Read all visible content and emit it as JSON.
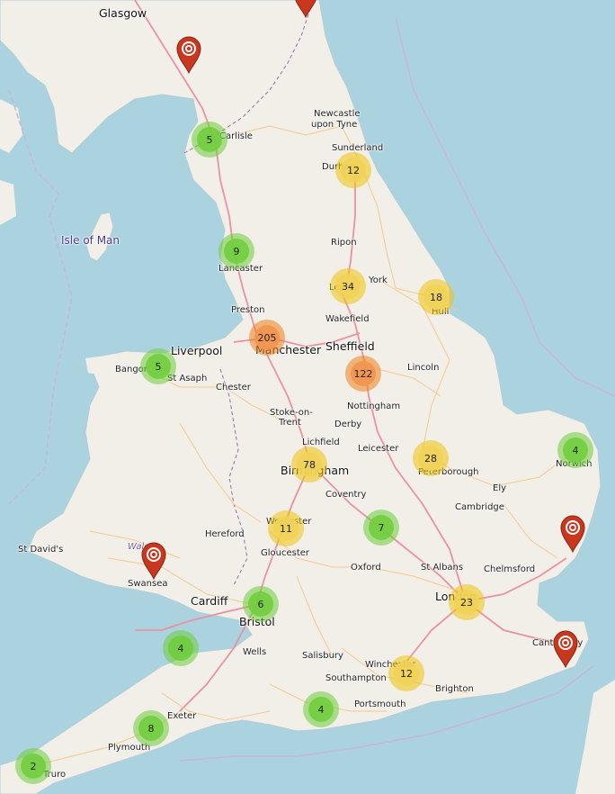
{
  "map": {
    "places": [
      {
        "id": "glasgow",
        "name": "Glasgow",
        "size": "big"
      },
      {
        "id": "carlisle",
        "name": "Carlisle",
        "size": "normal"
      },
      {
        "id": "newcastle-1",
        "name": "Newcastle",
        "size": "normal"
      },
      {
        "id": "newcastle-2",
        "name": "upon Tyne",
        "size": "normal"
      },
      {
        "id": "sunderland",
        "name": "Sunderland",
        "size": "normal"
      },
      {
        "id": "durham",
        "name": "Durham",
        "size": "normal"
      },
      {
        "id": "isle-of-man",
        "name": "Isle of Man",
        "size": "water"
      },
      {
        "id": "ripon",
        "name": "Ripon",
        "size": "normal"
      },
      {
        "id": "lancaster",
        "name": "Lancaster",
        "size": "normal"
      },
      {
        "id": "york",
        "name": "York",
        "size": "normal"
      },
      {
        "id": "leeds",
        "name": "Leeds",
        "size": "normal"
      },
      {
        "id": "hull",
        "name": "Hull",
        "size": "normal"
      },
      {
        "id": "preston",
        "name": "Preston",
        "size": "normal"
      },
      {
        "id": "wakefield",
        "name": "Wakefield",
        "size": "normal"
      },
      {
        "id": "liverpool",
        "name": "Liverpool",
        "size": "big"
      },
      {
        "id": "manchester",
        "name": "Manchester",
        "size": "big"
      },
      {
        "id": "sheffield",
        "name": "Sheffield",
        "size": "big"
      },
      {
        "id": "bangor",
        "name": "Bangor",
        "size": "normal"
      },
      {
        "id": "st-asaph",
        "name": "St Asaph",
        "size": "normal"
      },
      {
        "id": "chester",
        "name": "Chester",
        "size": "normal"
      },
      {
        "id": "lincoln",
        "name": "Lincoln",
        "size": "normal"
      },
      {
        "id": "nottingham",
        "name": "Nottingham",
        "size": "normal"
      },
      {
        "id": "stoke-1",
        "name": "Stoke-on-",
        "size": "normal"
      },
      {
        "id": "stoke-2",
        "name": "Trent",
        "size": "normal"
      },
      {
        "id": "derby",
        "name": "Derby",
        "size": "normal"
      },
      {
        "id": "lichfield",
        "name": "Lichfield",
        "size": "normal"
      },
      {
        "id": "leicester",
        "name": "Leicester",
        "size": "normal"
      },
      {
        "id": "birmingham",
        "name": "Birmingham",
        "size": "big"
      },
      {
        "id": "peterborough",
        "name": "Peterborough",
        "size": "normal"
      },
      {
        "id": "norwich",
        "name": "Norwich",
        "size": "normal"
      },
      {
        "id": "coventry",
        "name": "Coventry",
        "size": "normal"
      },
      {
        "id": "ely",
        "name": "Ely",
        "size": "normal"
      },
      {
        "id": "worcester",
        "name": "Worcester",
        "size": "normal"
      },
      {
        "id": "cambridge",
        "name": "Cambridge",
        "size": "normal"
      },
      {
        "id": "hereford",
        "name": "Hereford",
        "size": "normal"
      },
      {
        "id": "gloucester",
        "name": "Gloucester",
        "size": "normal"
      },
      {
        "id": "st-davids",
        "name": "St David's",
        "size": "normal"
      },
      {
        "id": "wales",
        "name": "Wales",
        "size": "region"
      },
      {
        "id": "oxford",
        "name": "Oxford",
        "size": "normal"
      },
      {
        "id": "st-albans",
        "name": "St Albans",
        "size": "normal"
      },
      {
        "id": "chelmsford",
        "name": "Chelmsford",
        "size": "normal"
      },
      {
        "id": "swansea",
        "name": "Swansea",
        "size": "normal"
      },
      {
        "id": "cardiff",
        "name": "Cardiff",
        "size": "big"
      },
      {
        "id": "london",
        "name": "London",
        "size": "big"
      },
      {
        "id": "bristol",
        "name": "Bristol",
        "size": "big"
      },
      {
        "id": "canterbury",
        "name": "Canterbury",
        "size": "normal"
      },
      {
        "id": "wells",
        "name": "Wells",
        "size": "normal"
      },
      {
        "id": "salisbury",
        "name": "Salisbury",
        "size": "normal"
      },
      {
        "id": "winchester",
        "name": "Winchester",
        "size": "normal"
      },
      {
        "id": "southampton",
        "name": "Southampton",
        "size": "normal"
      },
      {
        "id": "brighton",
        "name": "Brighton",
        "size": "normal"
      },
      {
        "id": "portsmouth",
        "name": "Portsmouth",
        "size": "normal"
      },
      {
        "id": "exeter",
        "name": "Exeter",
        "size": "normal"
      },
      {
        "id": "plymouth",
        "name": "Plymouth",
        "size": "normal"
      },
      {
        "id": "truro",
        "name": "Truro",
        "size": "normal"
      }
    ],
    "clusters": [
      {
        "id": "carlisle",
        "count": "5",
        "level": "small"
      },
      {
        "id": "durham",
        "count": "12",
        "level": "medium"
      },
      {
        "id": "lancaster",
        "count": "9",
        "level": "small"
      },
      {
        "id": "leeds",
        "count": "34",
        "level": "medium"
      },
      {
        "id": "hull",
        "count": "18",
        "level": "medium"
      },
      {
        "id": "manchester",
        "count": "205",
        "level": "large"
      },
      {
        "id": "bangor",
        "count": "5",
        "level": "small"
      },
      {
        "id": "sheffield",
        "count": "122",
        "level": "large"
      },
      {
        "id": "birmingham",
        "count": "78",
        "level": "medium"
      },
      {
        "id": "peterborough",
        "count": "28",
        "level": "medium"
      },
      {
        "id": "norwich",
        "count": "4",
        "level": "small"
      },
      {
        "id": "worcester",
        "count": "11",
        "level": "medium"
      },
      {
        "id": "northampton",
        "count": "7",
        "level": "small"
      },
      {
        "id": "bristol",
        "count": "6",
        "level": "small"
      },
      {
        "id": "london",
        "count": "23",
        "level": "medium"
      },
      {
        "id": "barnstaple",
        "count": "4",
        "level": "small"
      },
      {
        "id": "winchester",
        "count": "12",
        "level": "medium"
      },
      {
        "id": "exeter",
        "count": "8",
        "level": "small"
      },
      {
        "id": "bournemouth",
        "count": "4",
        "level": "small"
      },
      {
        "id": "truro",
        "count": "2",
        "level": "small"
      }
    ],
    "markers": [
      {
        "id": "top-center"
      },
      {
        "id": "dumfries"
      },
      {
        "id": "swansea"
      },
      {
        "id": "ipswich"
      },
      {
        "id": "canterbury"
      }
    ],
    "colors": {
      "sea": "#aad3df",
      "land": "#f2efe9",
      "motorway": "#e892a2",
      "road": "#f7d9a9",
      "border": "#8d71a8",
      "marker": "#c9371f"
    }
  }
}
